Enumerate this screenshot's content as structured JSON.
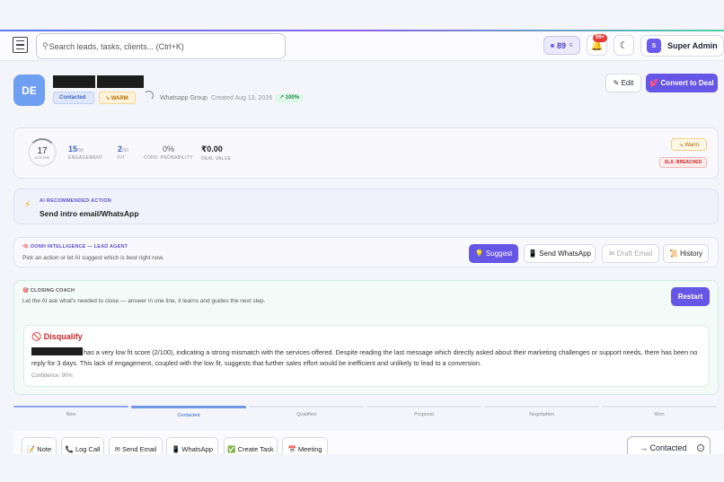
{
  "search": {
    "placeholder": "Search leads, tasks, clients... (Ctrl+K)"
  },
  "header": {
    "score_value": "89",
    "score_suffix": "⇅",
    "notifications_badge": "99+",
    "user_initial": "S",
    "user_name": "Super Admin"
  },
  "lead": {
    "initials": "DE",
    "status_tag": "Contacted",
    "temperature_tag": "↘ WARM",
    "spinner_label": "…",
    "source": "Whatsapp Group",
    "created": "Created Aug 13, 2026",
    "completion": "↗ 100%",
    "edit_label": "✎ Edit",
    "convert_label": "💕 Convert to Deal"
  },
  "metrics": {
    "ai_score": {
      "value": "17",
      "label": "AI SCORE"
    },
    "engagement": {
      "value": "15",
      "max": "/50",
      "label": "ENGAGEMENT"
    },
    "fit": {
      "value": "2",
      "max": "/50",
      "label": "FIT"
    },
    "conv_probability": {
      "value": "0%",
      "label": "CONV. PROBABILITY"
    },
    "deal_value": {
      "value": "₹0.00",
      "label": "DEAL VALUE"
    },
    "temperature_pill": "↘ Warm",
    "sla_pill": "SLA: BREACHED"
  },
  "ai_action": {
    "label": "AI RECOMMENDED ACTION",
    "text": "Send intro email/WhatsApp"
  },
  "intelligence": {
    "label": "🧠 OONH INTELLIGENCE — LEAD AGENT",
    "subtitle": "Pick an action or let AI suggest which is best right now.",
    "buttons": {
      "suggest": "💡 Suggest",
      "send_whatsapp": "📱 Send WhatsApp",
      "draft_email": "✉ Draft Email",
      "history": "📜 History"
    }
  },
  "coach": {
    "label": "🎯 CLOSING COACH",
    "subtitle": "Let the AI ask what's needed to close — answer in one line, it learns and guides the next step.",
    "restart_label": "Restart",
    "verdict_title": "🚫 Disqualify",
    "verdict_body": "has a very low fit score (2/100), indicating a strong mismatch with the services offered. Despite reading the last message which directly asked about their marketing challenges or support needs, there has been no reply for 3 days. This lack of engagement, coupled with the low fit, suggests that further sales effort would be inefficient and unlikely to lead to a conversion.",
    "confidence": "Confidence: 90%"
  },
  "pipeline": {
    "stages": [
      "New",
      "Contacted",
      "Qualified",
      "Proposal",
      "Negotiation",
      "Won"
    ],
    "current": "Contacted"
  },
  "actions": {
    "note": "📝 Note",
    "log_call": "📞 Log Call",
    "send_email": "✉ Send Email",
    "whatsapp": "📱 WhatsApp",
    "create_task": "✅ Create Task",
    "meeting": "📅 Meeting",
    "stage_select": "→ Contacted"
  },
  "colors": {
    "accent": "#6656e6",
    "danger": "#c62828",
    "warm": "#b06800",
    "success": "#1d8a4a"
  }
}
